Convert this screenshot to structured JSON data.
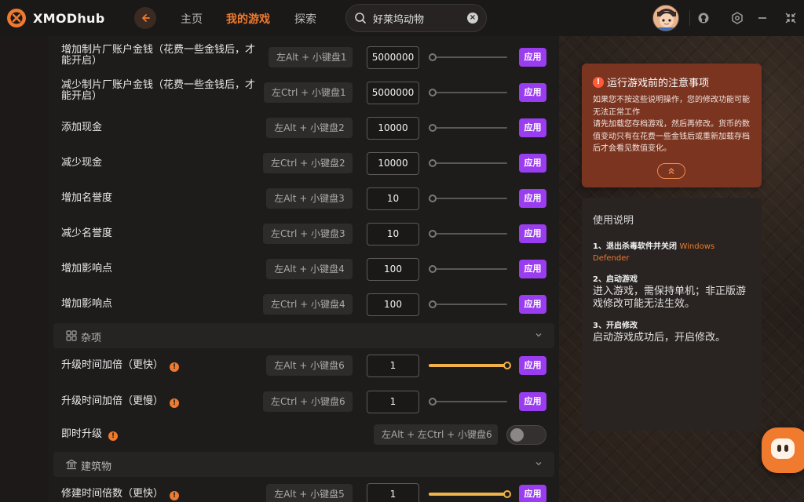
{
  "app": {
    "name": "XMODhub"
  },
  "nav": {
    "home": "主页",
    "my_games": "我的游戏",
    "explore": "探索"
  },
  "search": {
    "value": "好莱坞动物"
  },
  "colors": {
    "accent": "#f07a2d",
    "apply": "#9a3df0",
    "slider_fill": "#f2b24a",
    "notice_bg": "#7a3420"
  },
  "rows_a": [
    {
      "label": "增加制片厂账户金钱（花费一些金钱后，才能开启）",
      "hotkey": "左Alt + 小键盘1",
      "value": "5000000",
      "slider": 0,
      "apply": "应用"
    },
    {
      "label": "减少制片厂账户金钱（花费一些金钱后，才能开启）",
      "hotkey": "左Ctrl + 小键盘1",
      "value": "5000000",
      "slider": 0,
      "apply": "应用"
    },
    {
      "label": "添加现金",
      "hotkey": "左Alt + 小键盘2",
      "value": "10000",
      "slider": 0,
      "apply": "应用"
    },
    {
      "label": "减少现金",
      "hotkey": "左Ctrl + 小键盘2",
      "value": "10000",
      "slider": 0,
      "apply": "应用"
    },
    {
      "label": "增加名誉度",
      "hotkey": "左Alt + 小键盘3",
      "value": "10",
      "slider": 0,
      "apply": "应用"
    },
    {
      "label": "减少名誉度",
      "hotkey": "左Ctrl + 小键盘3",
      "value": "10",
      "slider": 0,
      "apply": "应用"
    },
    {
      "label": "增加影响点",
      "hotkey": "左Alt + 小键盘4",
      "value": "100",
      "slider": 0,
      "apply": "应用"
    },
    {
      "label": "增加影响点",
      "hotkey": "左Ctrl + 小键盘4",
      "value": "100",
      "slider": 0,
      "apply": "应用"
    }
  ],
  "section_misc": {
    "title": "杂项"
  },
  "rows_b": [
    {
      "label": "升级时间加倍（更快）",
      "hotkey": "左Alt + 小键盘6",
      "value": "1",
      "slider": 1,
      "apply": "应用"
    },
    {
      "label": "升级时间加倍（更慢）",
      "hotkey": "左Ctrl + 小键盘6",
      "value": "1",
      "slider": 0,
      "apply": "应用"
    }
  ],
  "toggle_row": {
    "label": "即时升级",
    "hotkey": "左Alt + 左Ctrl + 小键盘6",
    "on": false
  },
  "section_build": {
    "title": "建筑物"
  },
  "rows_c": [
    {
      "label": "修建时间倍数（更快）",
      "hotkey": "左Alt + 小键盘5",
      "value": "1",
      "slider": 1,
      "apply": "应用"
    }
  ],
  "notice": {
    "title": "运行游戏前的注意事项",
    "line1": "如果您不按这些说明操作，您的修改功能可能无法正常工作",
    "line2": "请先加载您存档游戏，然后再修改。货币的数值变动只有在花费一些金钱后或重新加载存档后才会看见数值变化。"
  },
  "usage": {
    "title": "使用说明",
    "step1_head": "1、退出杀毒软件并关闭",
    "step1_highlight": "Windows Defender",
    "step2_head": "2、启动游戏",
    "step2_body": "进入游戏，需保持单机；非正版游戏修改可能无法生效。",
    "step3_head": "3、开启修改",
    "step3_body": "启动游戏成功后，开启修改。"
  }
}
